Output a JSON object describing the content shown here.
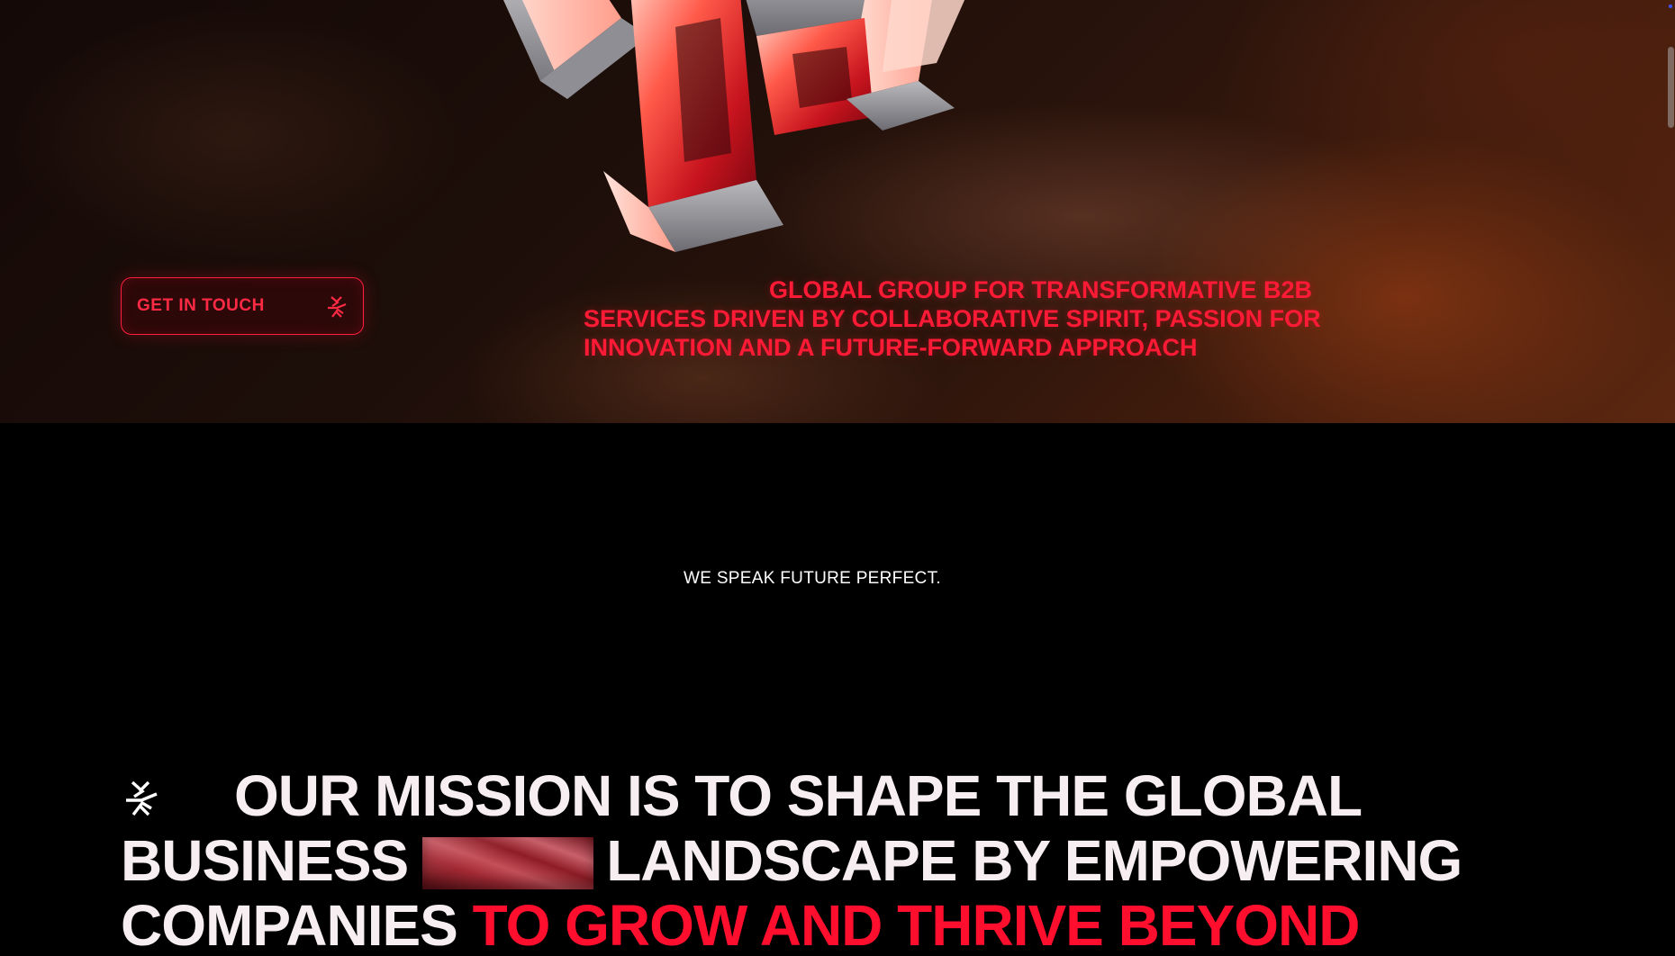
{
  "colors": {
    "accent": "#ff1a36",
    "background": "#000000",
    "text": "#f6eef0"
  },
  "hero": {
    "image_icon": "3d-red-letter-sculpture",
    "cta": {
      "label": "GET IN TOUCH",
      "icon": "brand-mark-icon"
    },
    "tagline": {
      "line1": "GLOBAL GROUP FOR TRANSFORMATIVE B2B",
      "line2": "SERVICES DRIVEN BY COLLABORATIVE SPIRIT, PASSION FOR",
      "line3": "INNOVATION AND A FUTURE-FORWARD APPROACH"
    }
  },
  "slogan": "WE SPEAK FUTURE PERFECT.",
  "mission": {
    "logo_icon": "brand-mark-icon",
    "row1": "OUR MISSION IS TO SHAPE THE GLOBAL",
    "row2_a": "BUSINESS",
    "row2_b": "LANDSCAPE BY EMPOWERING",
    "row3_a": "COMPANIES",
    "row3_accent": "TO GROW AND THRIVE BEYOND"
  }
}
